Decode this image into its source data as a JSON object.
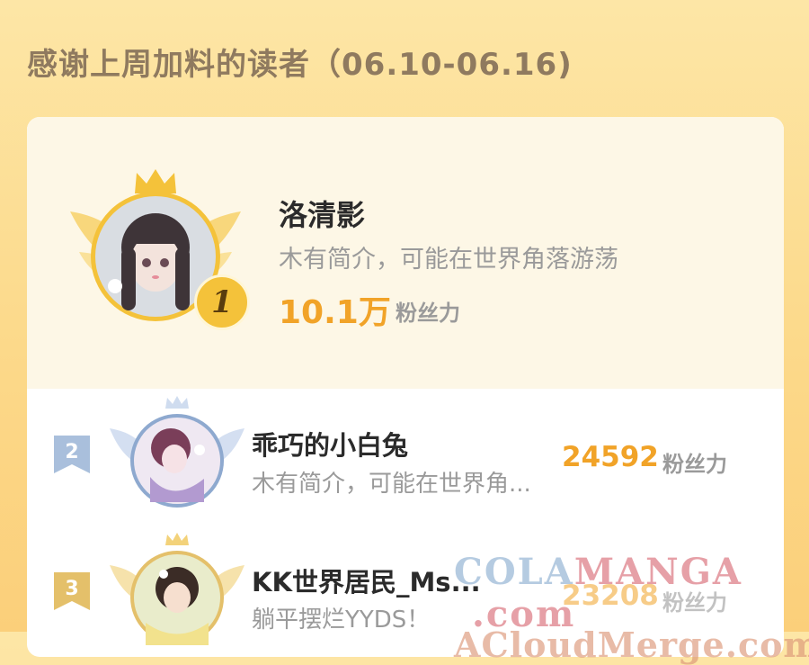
{
  "header": {
    "title": "感谢上周加料的读者（06.10-06.16)"
  },
  "top_reader": {
    "rank": "1",
    "name": "洛清影",
    "bio": "木有简介，可能在世界角落游荡",
    "score": "10.1万",
    "score_unit": "粉丝力"
  },
  "readers": [
    {
      "rank": "2",
      "name": "乖巧的小白兔",
      "bio": "木有简介，可能在世界角...",
      "score": "24592",
      "score_unit": "粉丝力"
    },
    {
      "rank": "3",
      "name": "KK世界居民_Ms...",
      "bio": "躺平摆烂YYDS！",
      "score": "23208",
      "score_unit": "粉丝力"
    }
  ],
  "watermark": {
    "line1_a": "COLA",
    "line1_b": "MANGA",
    "line1_c": ".com",
    "line2": "ACloudMerge.com"
  },
  "colors": {
    "accent": "#f1a328",
    "gold": "#f4c23a",
    "silver": "#a9bfdc",
    "bronze": "#e4c06a",
    "title": "#8f7a5f",
    "muted": "#9a9a9a"
  },
  "icons": [
    "crown-icon",
    "laurel-wings-icon",
    "rank-medal-icon",
    "rank-ribbon-icon"
  ]
}
